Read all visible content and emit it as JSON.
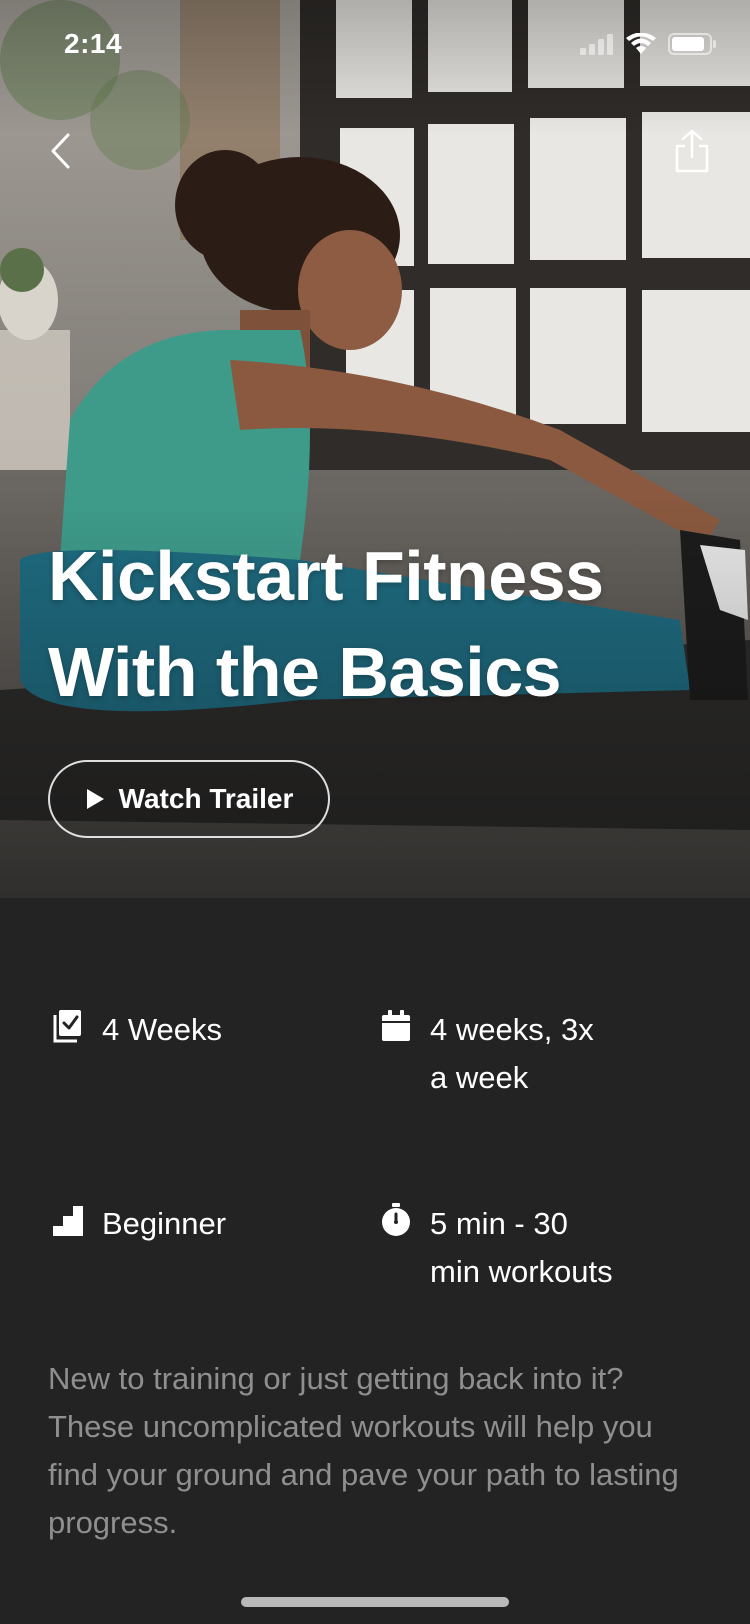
{
  "status_bar": {
    "time": "2:14"
  },
  "nav": {
    "back_icon": "chevron-left-icon",
    "share_icon": "share-icon"
  },
  "hero": {
    "title_line1": "Kickstart Fitness",
    "title_line2": "With the Basics",
    "trailer_label": "Watch Trailer"
  },
  "meta": [
    {
      "icon": "checklist-icon",
      "text_line1": "4 Weeks",
      "text_line2": ""
    },
    {
      "icon": "calendar-icon",
      "text_line1": "4 weeks, 3x",
      "text_line2": "a week"
    },
    {
      "icon": "stairs-level-icon",
      "text_line1": "Beginner",
      "text_line2": ""
    },
    {
      "icon": "stopwatch-icon",
      "text_line1": "5 min - 30",
      "text_line2": "min workouts"
    }
  ],
  "description": "New to training or just getting back into it? These uncomplicated workouts will help you find your ground and pave your path to lasting progress.",
  "colors": {
    "background": "#232323",
    "description_text": "#8f8f8f",
    "title_text": "#ffffff"
  }
}
